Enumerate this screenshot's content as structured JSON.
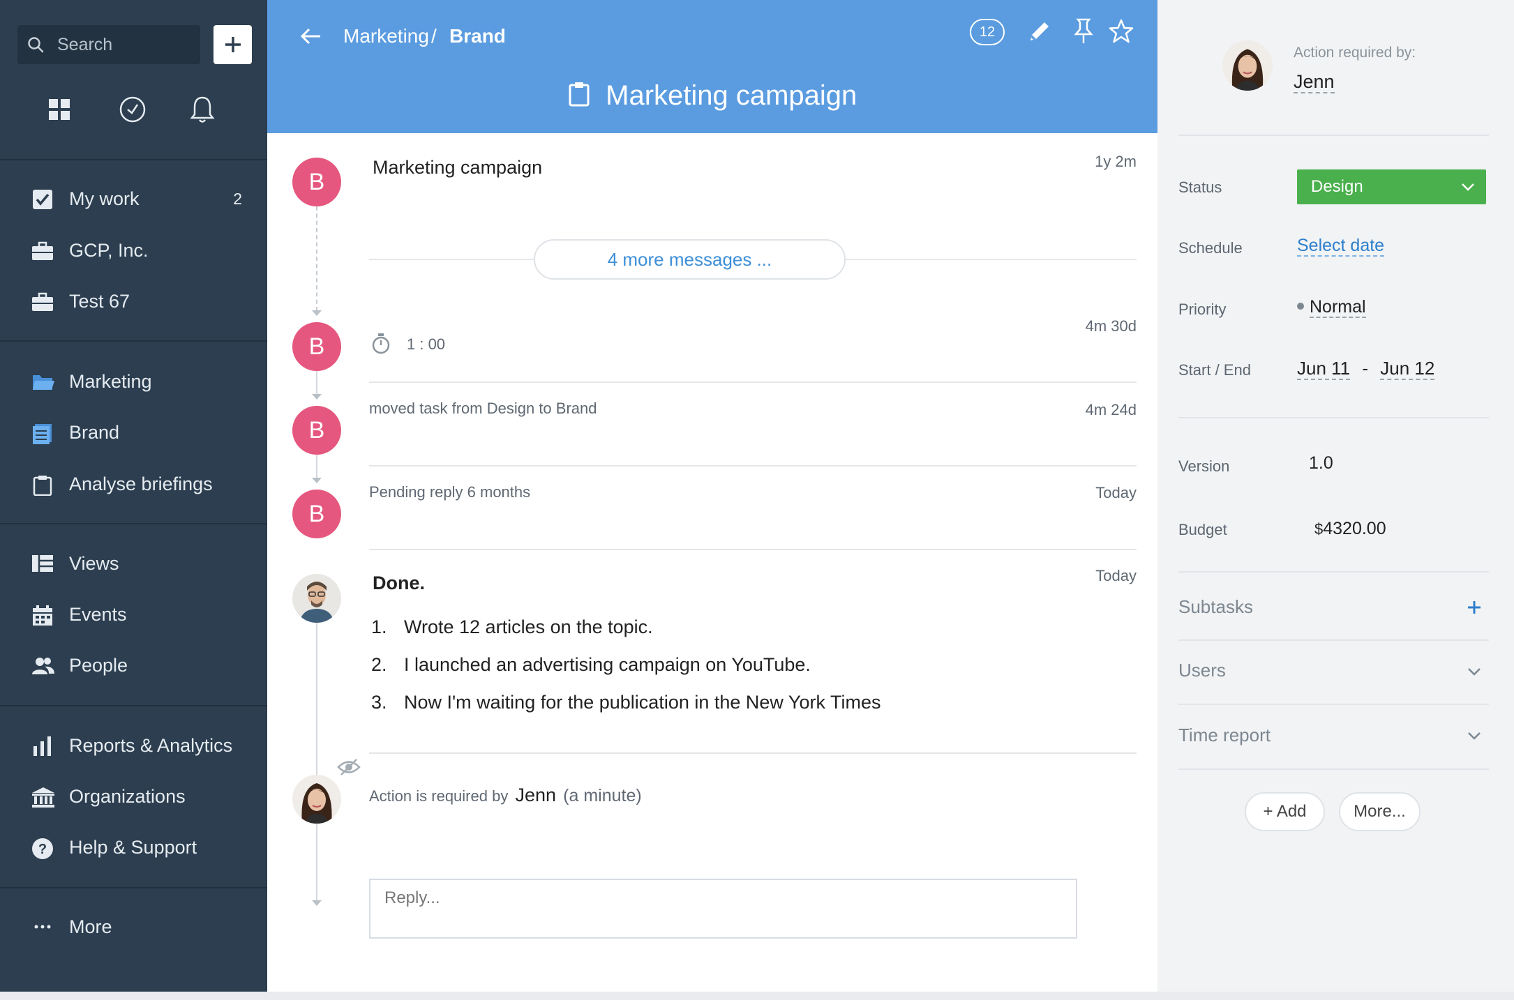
{
  "colors": {
    "sidebar_bg": "#2c3e4f",
    "header_bg": "#5b9ce0",
    "avatar_bg": "#e5577e",
    "status_bg": "#4ab04d",
    "link": "#2e7fcc"
  },
  "sidebar": {
    "search_placeholder": "Search",
    "top_icons": [
      "grid-icon",
      "clock-icon",
      "bell-icon"
    ],
    "groups": [
      [
        {
          "label": "My work",
          "icon": "checkbox-icon",
          "count": "2"
        },
        {
          "label": "GCP, Inc.",
          "icon": "briefcase-icon"
        },
        {
          "label": "Test 67",
          "icon": "briefcase-icon"
        }
      ],
      [
        {
          "label": "Marketing",
          "icon": "folder-icon"
        },
        {
          "label": "Brand",
          "icon": "list-icon"
        },
        {
          "label": "Analyse briefings",
          "icon": "clipboard-icon"
        }
      ],
      [
        {
          "label": "Views",
          "icon": "views-icon"
        },
        {
          "label": "Events",
          "icon": "calendar-icon"
        },
        {
          "label": "People",
          "icon": "people-icon"
        }
      ],
      [
        {
          "label": "Reports & Analytics",
          "icon": "bar-chart-icon"
        },
        {
          "label": "Organizations",
          "icon": "bank-icon"
        },
        {
          "label": "Help & Support",
          "icon": "help-icon"
        }
      ],
      [
        {
          "label": "More",
          "icon": "dots-icon"
        }
      ]
    ]
  },
  "header": {
    "breadcrumb": {
      "parent": "Marketing",
      "separator": "/",
      "current": "Brand"
    },
    "count": "12",
    "title": "Marketing campaign"
  },
  "feed": {
    "first": {
      "title": "Marketing campaign",
      "time": "1y 2m",
      "avatar": "B"
    },
    "more_messages": "4 more messages ...",
    "timer": {
      "value": "1 : 00",
      "time": "4m 30d",
      "avatar": "B"
    },
    "moved": {
      "text": "moved task from Design to Brand",
      "time": "4m 24d",
      "avatar": "B"
    },
    "pending": {
      "text": "Pending reply 6 months",
      "time": "Today",
      "avatar": "B"
    },
    "done": {
      "title": "Done.",
      "time": "Today",
      "items": [
        {
          "num": "1.",
          "text": "Wrote 12 articles on the topic."
        },
        {
          "num": "2.",
          "text": "I launched an advertising campaign on YouTube."
        },
        {
          "num": "3.",
          "text": "Now I'm waiting for the publication in the New York Times"
        }
      ]
    },
    "action": {
      "prefix": "Action is required by",
      "name": "Jenn",
      "suffix": "(a minute)"
    },
    "reply_placeholder": "Reply..."
  },
  "panel": {
    "action_required_label": "Action required by:",
    "action_required_name": "Jenn",
    "status": {
      "label": "Status",
      "value": "Design"
    },
    "schedule": {
      "label": "Schedule",
      "value": "Select date"
    },
    "priority": {
      "label": "Priority",
      "value": "Normal"
    },
    "start_end": {
      "label": "Start / End",
      "start": "Jun 11",
      "separator": "-",
      "end": "Jun 12"
    },
    "version": {
      "label": "Version",
      "value": "1.0"
    },
    "budget": {
      "label": "Budget",
      "currency": "$",
      "value": "4320.00"
    },
    "sections": {
      "subtasks": "Subtasks",
      "users": "Users",
      "time_report": "Time report"
    },
    "add_button": "+ Add",
    "more_button": "More..."
  }
}
